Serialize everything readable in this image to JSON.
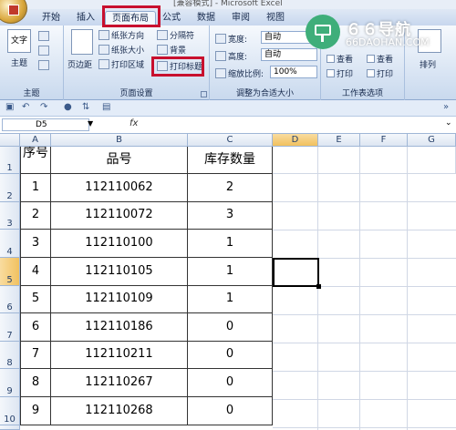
{
  "window": {
    "title_partial": "[兼容模式] - Microsoft Excel"
  },
  "tabs": [
    {
      "label": "开始"
    },
    {
      "label": "插入"
    },
    {
      "label": "页面布局"
    },
    {
      "label": "公式"
    },
    {
      "label": "数据"
    },
    {
      "label": "审阅"
    },
    {
      "label": "视图"
    }
  ],
  "ribbon": {
    "themes": {
      "label": "主题",
      "big_button": "主题",
      "theme_icon_text": "文字"
    },
    "page_setup": {
      "label": "页面设置",
      "margins": "页边距",
      "orientation": "纸张方向",
      "size": "纸张大小",
      "print_area": "打印区域",
      "breaks": "分隔符",
      "background": "背景",
      "print_titles": "打印标题"
    },
    "scale_to_fit": {
      "label": "调整为合适大小",
      "width_label": "宽度:",
      "width_value": "自动",
      "height_label": "高度:",
      "height_value": "自动",
      "scale_label": "缩放比例:",
      "scale_value": "100%"
    },
    "sheet_options": {
      "label": "工作表选项",
      "view_left": "查看",
      "view_right": "查看",
      "print_left": "打印",
      "print_right": "打印"
    },
    "arrange": {
      "label": "排列"
    }
  },
  "formula_bar": {
    "name_box": "D5",
    "fx": "fx",
    "content": ""
  },
  "columns": [
    "A",
    "B",
    "C",
    "D",
    "E",
    "F",
    "G"
  ],
  "selected_column": "D",
  "selected_row": "5",
  "table": {
    "headers": [
      "序号",
      "品号",
      "库存数量"
    ],
    "rows": [
      {
        "row": "2",
        "cells": [
          "1",
          "112110062",
          "2"
        ]
      },
      {
        "row": "3",
        "cells": [
          "2",
          "112110072",
          "3"
        ]
      },
      {
        "row": "4",
        "cells": [
          "3",
          "112110100",
          "1"
        ]
      },
      {
        "row": "5",
        "cells": [
          "4",
          "112110105",
          "1"
        ]
      },
      {
        "row": "6",
        "cells": [
          "5",
          "112110109",
          "1"
        ]
      },
      {
        "row": "7",
        "cells": [
          "6",
          "112110186",
          "0"
        ]
      },
      {
        "row": "8",
        "cells": [
          "7",
          "112110211",
          "0"
        ]
      },
      {
        "row": "9",
        "cells": [
          "8",
          "112110267",
          "0"
        ]
      },
      {
        "row": "10",
        "cells": [
          "9",
          "112110268",
          "0"
        ]
      }
    ]
  },
  "first_row_label": "1",
  "watermark": {
    "title": "６６导航",
    "subtitle": "66DAOHAN.COM"
  },
  "colors": {
    "highlight_box": "#c8102e",
    "ribbon_bg": "#dbe6f4",
    "header_selected": "#f1c15f"
  }
}
